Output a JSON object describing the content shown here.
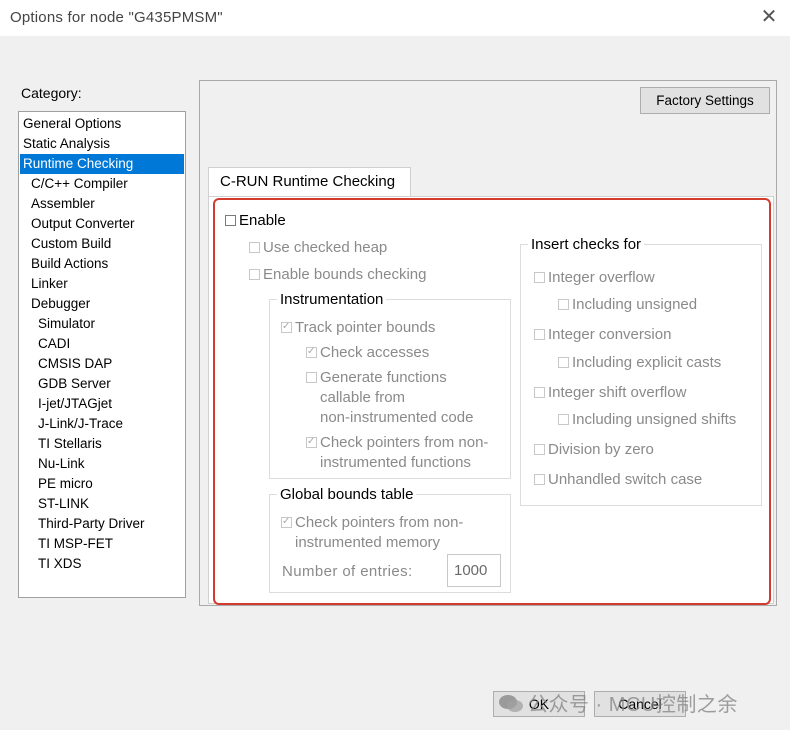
{
  "window": {
    "title": "Options for node \"G435PMSM\"",
    "close_glyph": "✕"
  },
  "category": {
    "label": "Category:",
    "items": [
      {
        "label": "General Options",
        "indent": 0
      },
      {
        "label": "Static Analysis",
        "indent": 0
      },
      {
        "label": "Runtime Checking",
        "indent": 0,
        "selected": true
      },
      {
        "label": "C/C++ Compiler",
        "indent": 1
      },
      {
        "label": "Assembler",
        "indent": 1
      },
      {
        "label": "Output Converter",
        "indent": 1
      },
      {
        "label": "Custom Build",
        "indent": 1
      },
      {
        "label": "Build Actions",
        "indent": 1
      },
      {
        "label": "Linker",
        "indent": 1
      },
      {
        "label": "Debugger",
        "indent": 1
      },
      {
        "label": "Simulator",
        "indent": 2
      },
      {
        "label": "CADI",
        "indent": 2
      },
      {
        "label": "CMSIS DAP",
        "indent": 2
      },
      {
        "label": "GDB Server",
        "indent": 2
      },
      {
        "label": "I-jet/JTAGjet",
        "indent": 2
      },
      {
        "label": "J-Link/J-Trace",
        "indent": 2
      },
      {
        "label": "TI Stellaris",
        "indent": 2
      },
      {
        "label": "Nu-Link",
        "indent": 2
      },
      {
        "label": "PE micro",
        "indent": 2
      },
      {
        "label": "ST-LINK",
        "indent": 2
      },
      {
        "label": "Third-Party Driver",
        "indent": 2
      },
      {
        "label": "TI MSP-FET",
        "indent": 2
      },
      {
        "label": "TI XDS",
        "indent": 2
      }
    ]
  },
  "factory_settings_label": "Factory Settings",
  "tab_label": "C-RUN Runtime Checking",
  "enable": {
    "label": "Enable",
    "checked": false
  },
  "use_checked_heap": {
    "label": "Use checked heap",
    "checked": false
  },
  "enable_bounds_checking": {
    "label": "Enable bounds checking",
    "checked": false
  },
  "instrumentation": {
    "title": "Instrumentation",
    "track_pointer_bounds": {
      "label": "Track pointer bounds",
      "checked": true
    },
    "check_accesses": {
      "label": "Check accesses",
      "checked": true
    },
    "generate_functions": {
      "line1": "Generate functions",
      "line2": "callable from",
      "line3": "non-instrumented code",
      "checked": false
    },
    "check_pointers_fn": {
      "line1": "Check pointers from non-",
      "line2": "instrumented functions",
      "checked": true
    }
  },
  "global_bounds": {
    "title": "Global bounds table",
    "check_pointers_mem": {
      "line1": "Check pointers from non-",
      "line2": "instrumented memory",
      "checked": true
    },
    "num_entries_label": "Number of entries:",
    "num_entries_value": "1000"
  },
  "insert_checks": {
    "title": "Insert checks for",
    "integer_overflow": {
      "label": "Integer overflow",
      "checked": false
    },
    "including_unsigned": {
      "label": "Including unsigned",
      "checked": false
    },
    "integer_conversion": {
      "label": "Integer conversion",
      "checked": false
    },
    "including_explicit_casts": {
      "label": "Including explicit casts",
      "checked": false
    },
    "integer_shift_overflow": {
      "label": "Integer shift overflow",
      "checked": false
    },
    "including_unsigned_shifts": {
      "label": "Including unsigned shifts",
      "checked": false
    },
    "division_by_zero": {
      "label": "Division by zero",
      "checked": false
    },
    "unhandled_switch_case": {
      "label": "Unhandled switch case",
      "checked": false
    }
  },
  "buttons": {
    "ok": "OK",
    "cancel": "Cancel"
  },
  "watermark": "公众号 · MCU控制之余",
  "colors": {
    "selection": "#0078d7",
    "highlight_border": "#d23b2e"
  }
}
